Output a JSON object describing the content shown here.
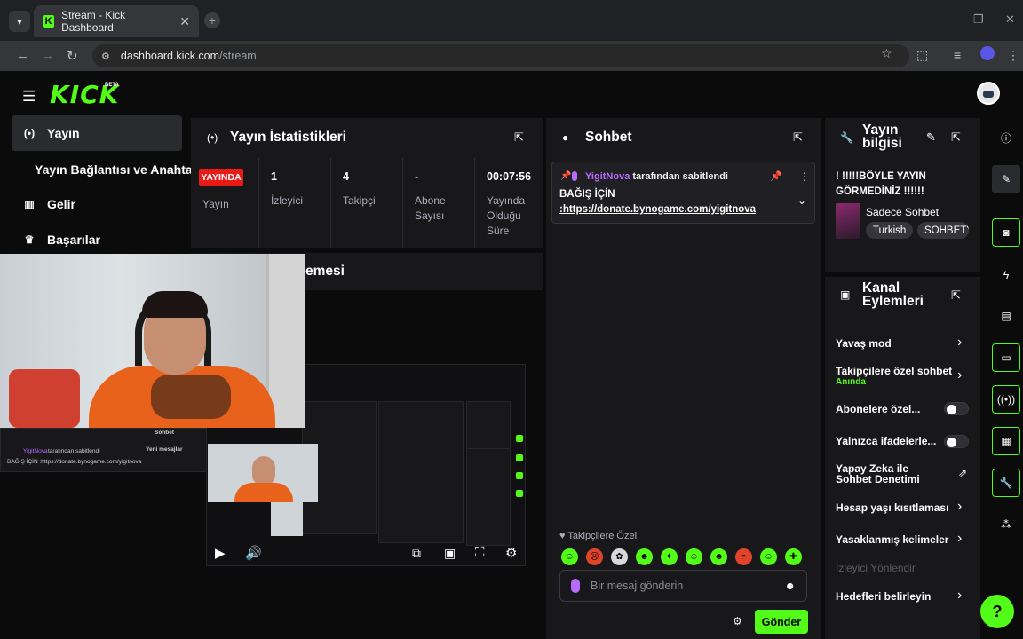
{
  "browser": {
    "tab_title": "Stream - Kick Dashboard",
    "favicon_letter": "K",
    "url_host": "dashboard.kick.com",
    "url_path": "/stream"
  },
  "header": {
    "logo_text": "KICK",
    "beta_label": "BETA"
  },
  "sidebar": {
    "items": [
      {
        "label": "Yayın",
        "icon": "broadcast-icon"
      },
      {
        "label": "Yayın Bağlantısı ve Anahtarı"
      },
      {
        "label": "Gelir",
        "icon": "chart-icon"
      },
      {
        "label": "Başarılar",
        "icon": "trophy-icon"
      }
    ]
  },
  "stats": {
    "title": "Yayın İstatistikleri",
    "live_badge": "YAYINDA",
    "live_label": "Yayın",
    "items": [
      {
        "value": "1",
        "label": "İzleyici"
      },
      {
        "value": "4",
        "label": "Takipçi"
      },
      {
        "value": "-",
        "label": "Abone Sayısı"
      },
      {
        "value": "00:07:56",
        "label": "Yayında Olduğu Süre"
      }
    ]
  },
  "preview": {
    "title_fragment": "emesi",
    "mini_chat_title": "Sohbet",
    "mini_new_messages": "Yeni mesajlar",
    "mini_pinned_user": "YigitNova",
    "mini_pinned_text": "tarafından sabitlendi",
    "mini_donation": "BAĞIŞ İÇİN :https://donate.bynogame.com/yigitnova"
  },
  "chat": {
    "title": "Sohbet",
    "pinned_user": "YigitNova",
    "pinned_by": "tarafından sabitlendi",
    "pinned_line1": "BAĞIŞ İÇİN",
    "pinned_line2": ":https://donate.bynogame.com/yigitnova",
    "followers_only": "Takipçilere Özel",
    "input_placeholder": "Bir mesaj gönderin",
    "send_label": "Gönder"
  },
  "stream_info": {
    "title": "Yayın bilgisi",
    "stream_title": "! !!!!!BÖYLE YAYIN GÖRMEDİNİZ !!!!!!",
    "category": "Sadece Sohbet",
    "tags": [
      "Turkish",
      "SOHBETY"
    ]
  },
  "channel_actions": {
    "title": "Kanal Eylemleri",
    "items": [
      {
        "label": "Yavaş mod",
        "control": "chevron"
      },
      {
        "label": "Takipçilere özel sohbet",
        "sub": "Anında",
        "control": "chevron"
      },
      {
        "label": "Abonelere özel...",
        "control": "toggle"
      },
      {
        "label": "Yalnızca ifadelerle...",
        "control": "toggle"
      },
      {
        "label": "Yapay Zeka ile Sohbet Denetimi",
        "control": "external"
      },
      {
        "label": "Hesap yaşı kısıtlaması",
        "control": "chevron"
      },
      {
        "label": "Yasaklanmış kelimeler",
        "control": "chevron"
      },
      {
        "label": "İzleyici Yönlendir",
        "control": "none"
      },
      {
        "label": "Hedefleri belirleyin",
        "control": "chevron"
      }
    ]
  },
  "colors": {
    "accent": "#53fc18",
    "live": "#e91916",
    "panel": "#18181b",
    "background": "#0b0b0c"
  }
}
